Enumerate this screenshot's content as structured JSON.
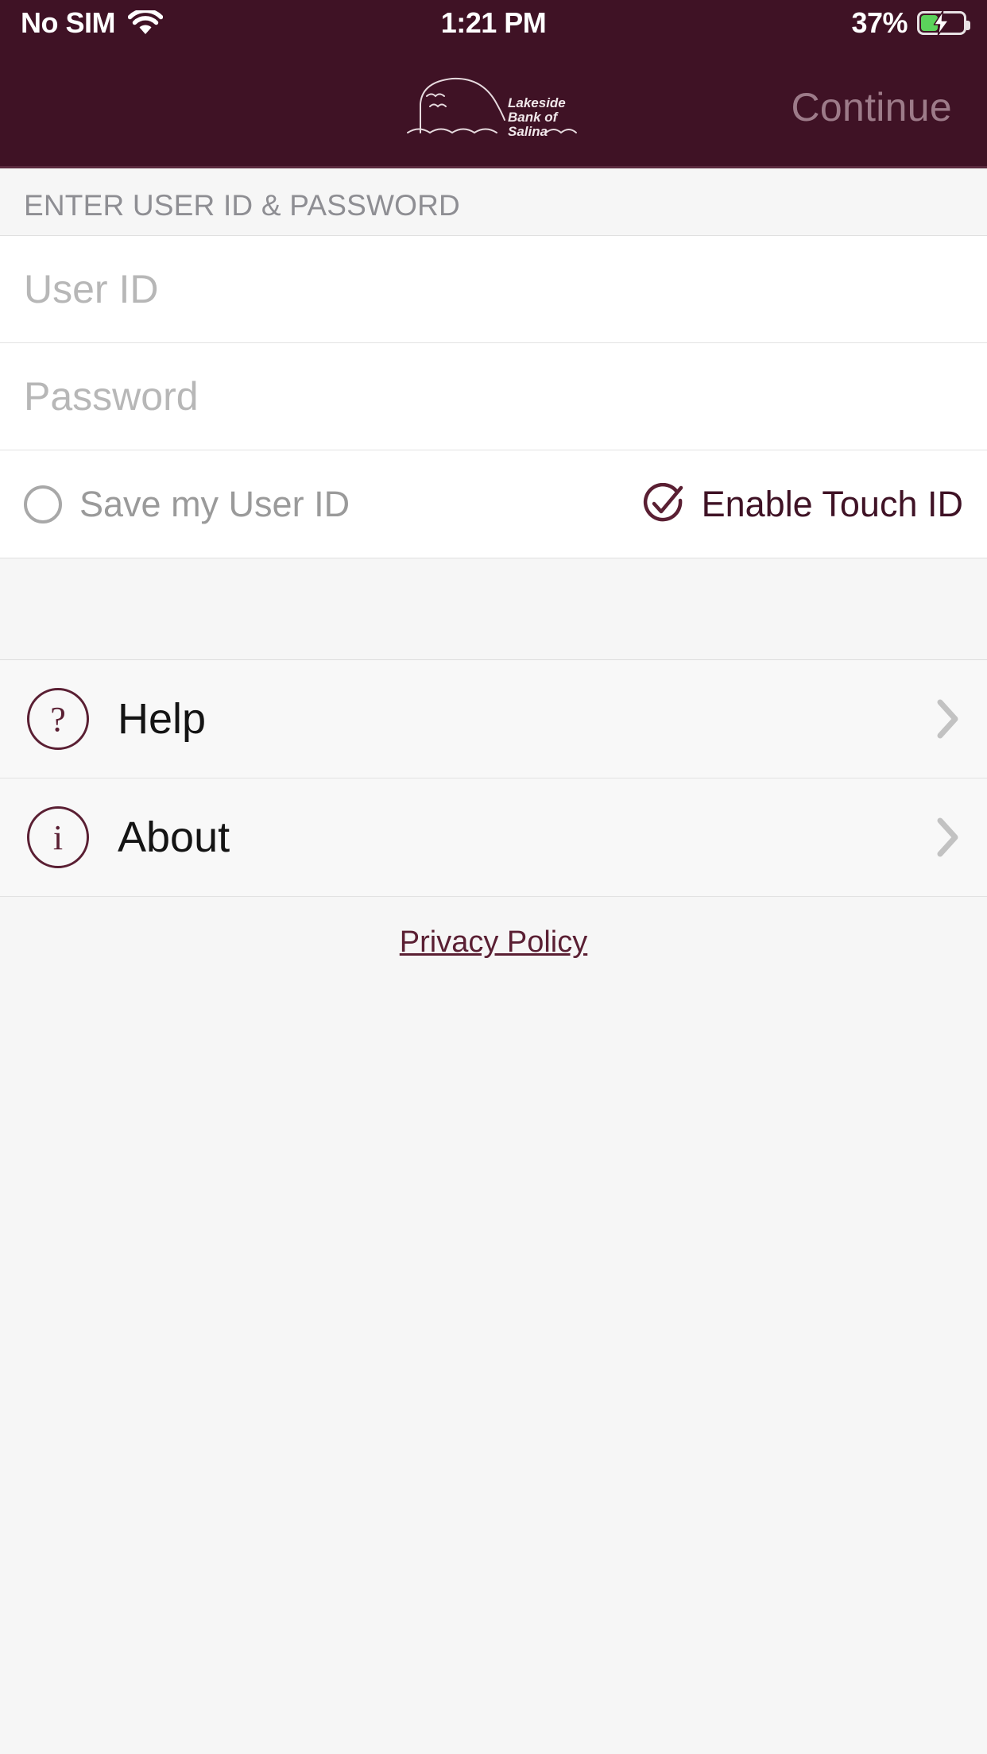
{
  "status_bar": {
    "carrier": "No SIM",
    "wifi_icon": "wifi-icon",
    "time": "1:21 PM",
    "battery_percent": "37%",
    "battery_level": 37,
    "battery_charging": true,
    "battery_icon": "battery-charging-icon"
  },
  "header": {
    "background_color": "#3f1225",
    "logo": {
      "icon_name": "lakeside-bank-logo",
      "line1": "Lakeside",
      "line2": "Bank of",
      "line3": "Salina"
    },
    "continue_label": "Continue",
    "continue_enabled": false,
    "continue_color": "#9d7b89"
  },
  "form": {
    "section_title": "ENTER USER ID & PASSWORD",
    "fields": [
      {
        "name": "user-id",
        "placeholder": "User ID",
        "value": "",
        "type": "text"
      },
      {
        "name": "password",
        "placeholder": "Password",
        "value": "",
        "type": "password"
      }
    ],
    "options": [
      {
        "name": "save-user-id",
        "label": "Save my User ID",
        "checked": false,
        "icon": "circle-outline-icon"
      },
      {
        "name": "enable-touch-id",
        "label": "Enable Touch ID",
        "checked": true,
        "icon": "check-circle-icon"
      }
    ]
  },
  "menu": {
    "items": [
      {
        "name": "help",
        "label": "Help",
        "icon": "question-mark-circle-icon",
        "glyph": "?",
        "chevron": "chevron-right-icon"
      },
      {
        "name": "about",
        "label": "About",
        "icon": "info-circle-icon",
        "glyph": "i",
        "chevron": "chevron-right-icon"
      }
    ]
  },
  "footer": {
    "privacy_label": "Privacy Policy"
  },
  "colors": {
    "brand_maroon": "#3f1225",
    "accent_maroon": "#5a1f33",
    "page_background": "#f6f6f6",
    "card_background": "#ffffff",
    "placeholder_gray": "#b7b7b7",
    "battery_green": "#5bd35b"
  }
}
